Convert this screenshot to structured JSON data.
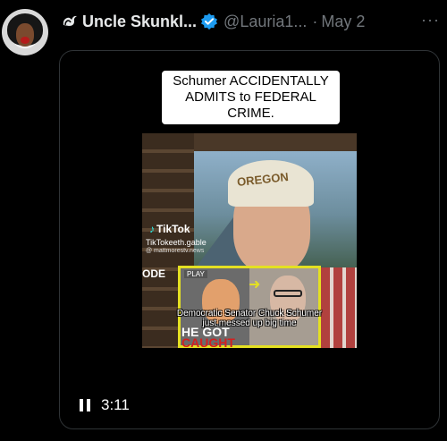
{
  "tweet": {
    "display_name": "Uncle Skunkl...",
    "handle": "@Lauria1...",
    "separator": "·",
    "date": "May 2",
    "more_label": "···"
  },
  "media": {
    "caption": "Schumer ACCIDENTALLY ADMITS to FEDERAL CRIME.",
    "video": {
      "cap_text": "OREGON",
      "tiktok_label": "TikTok",
      "tiktok_user": "TikTokeeth.gable",
      "tiktok_sub": "@ mattmorestv.news",
      "side_text": "ODE",
      "inset_play": "PLAY",
      "subtitle": "Democratic Senator Chuck Schumer just messed up big time",
      "caught_line1": "HE GOT",
      "caught_line2": "CAUGHT"
    },
    "time": "3:11"
  },
  "icons": {
    "avatar": "avatar",
    "skunk": "skunk-icon",
    "verified": "verified-badge-icon",
    "pause": "pause-icon"
  },
  "colors": {
    "verified": "#1d9bf0",
    "secondary_text": "#71767b",
    "border": "#2f3336"
  }
}
